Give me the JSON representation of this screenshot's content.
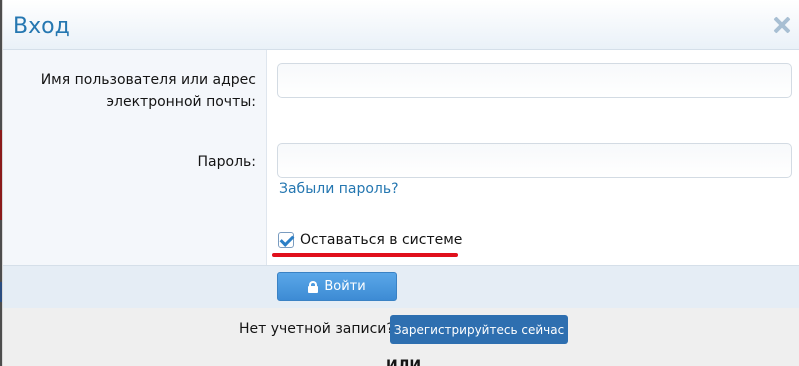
{
  "dialog": {
    "title": "Вход"
  },
  "form": {
    "username_label_line1": "Имя пользователя или адрес",
    "username_label_line2": "электронной почты:",
    "username_value": "",
    "password_label": "Пароль:",
    "password_value": "",
    "forgot_link": "Забыли пароль?",
    "remember_label": "Оставаться в системе",
    "remember_checked": true,
    "submit_label": "Войти"
  },
  "footer": {
    "no_account_text": "Нет учетной записи?",
    "register_label": "Зарегистрируйтесь сейчас",
    "or_text": "ИЛИ"
  },
  "icons": {
    "close": "close-icon",
    "lock": "lock-icon",
    "checkbox": "checkbox-checked-icon"
  },
  "colors": {
    "title": "#2577b1",
    "link": "#2577b1",
    "primary_button": "#4a9ade",
    "register_button": "#2e6fb0",
    "highlight_underline": "#e0101c"
  }
}
